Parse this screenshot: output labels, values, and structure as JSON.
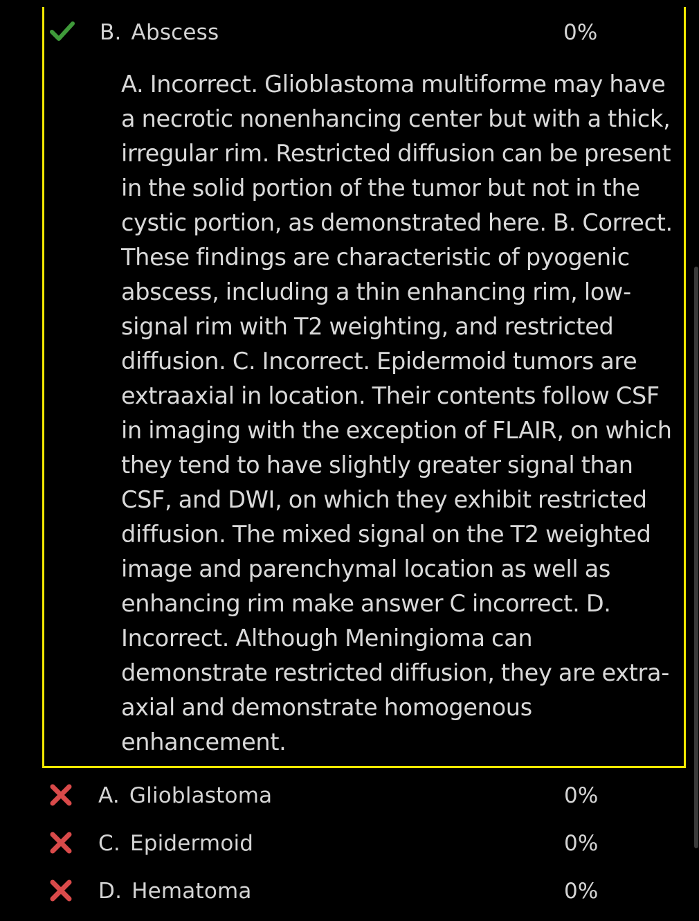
{
  "selected_answer": {
    "letter": "B.",
    "text": "Abscess",
    "percent": "0%",
    "status_icon": "checkmark-icon",
    "explanation": "A. Incorrect. Glioblastoma multiforme may have a necrotic nonenhancing center but with a thick, irregular rim. Restricted diffusion can be present in the solid portion of the tumor but not in the cystic portion, as demonstrated here. B. Correct. These findings are characteristic of pyogenic abscess, including a thin enhancing rim, low-signal rim with T2 weighting, and restricted diffusion. C. Incorrect. Epidermoid tumors are extraaxial in location. Their contents follow CSF in imaging with the exception of FLAIR, on which they tend to have slightly greater signal than CSF, and DWI, on which they exhibit restricted diffusion. The mixed signal on the T2 weighted image and parenchymal location as well as enhancing rim make answer C incorrect. D. Incorrect. Although Meningioma can demonstrate restricted diffusion, they are extra-axial and demonstrate homogenous enhancement."
  },
  "other_answers": [
    {
      "letter": "A.",
      "text": "Glioblastoma",
      "percent": "0%",
      "status_icon": "cross-icon"
    },
    {
      "letter": "C.",
      "text": "Epidermoid",
      "percent": "0%",
      "status_icon": "cross-icon"
    },
    {
      "letter": "D.",
      "text": "Hematoma",
      "percent": "0%",
      "status_icon": "cross-icon"
    }
  ],
  "colors": {
    "highlight_border": "#f2e800",
    "correct": "#3f9a3a",
    "incorrect": "#d94a4a",
    "background": "#000000",
    "text": "#d9d9d9"
  }
}
